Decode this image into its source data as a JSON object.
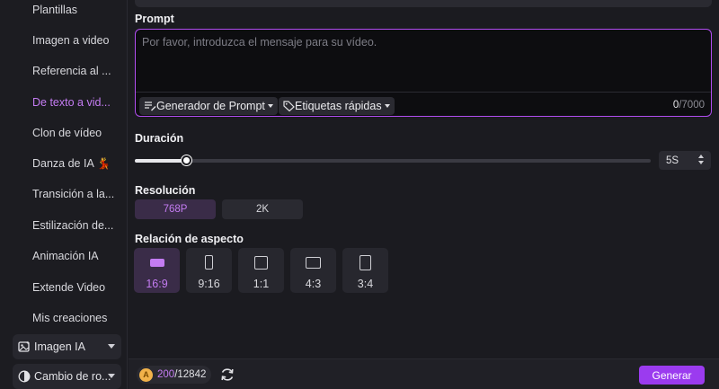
{
  "sidebar": {
    "items": [
      {
        "label": "Plantillas"
      },
      {
        "label": "Imagen a video"
      },
      {
        "label": "Referencia al ..."
      },
      {
        "label": "De texto a vid...",
        "active": true
      },
      {
        "label": "Clon de vídeo"
      },
      {
        "label": "Danza de IA 💃"
      },
      {
        "label": "Transición a la..."
      },
      {
        "label": "Estilización de..."
      },
      {
        "label": "Animación IA"
      },
      {
        "label": "Extende Video"
      },
      {
        "label": "Mis creaciones"
      }
    ],
    "groups": [
      {
        "label": "Imagen IA",
        "icon": "image-ai-icon"
      },
      {
        "label": "Cambio de ro...",
        "icon": "face-swap-icon"
      }
    ]
  },
  "prompt": {
    "label": "Prompt",
    "placeholder": "Por favor, introduzca el mensaje para su vídeo.",
    "value": "",
    "generator_label": "Generador de Prompt",
    "tags_label": "Etiquetas rápidas",
    "count_current": "0",
    "count_max": "/7000"
  },
  "duration": {
    "label": "Duración",
    "value": "5S",
    "slider_fraction": 0.1
  },
  "resolution": {
    "label": "Resolución",
    "options": [
      "768P",
      "2K"
    ],
    "selected": "768P"
  },
  "aspect": {
    "label": "Relación de aspecto",
    "options": [
      "16:9",
      "9:16",
      "1:1",
      "4:3",
      "3:4"
    ],
    "selected": "16:9"
  },
  "footer": {
    "coin_symbol": "A",
    "credits_used": "200",
    "credits_total": "/12842",
    "generate_label": "Generar"
  },
  "colors": {
    "accent": "#c47cf2",
    "button": "#9b3bef",
    "coin": "#f1b24a"
  }
}
